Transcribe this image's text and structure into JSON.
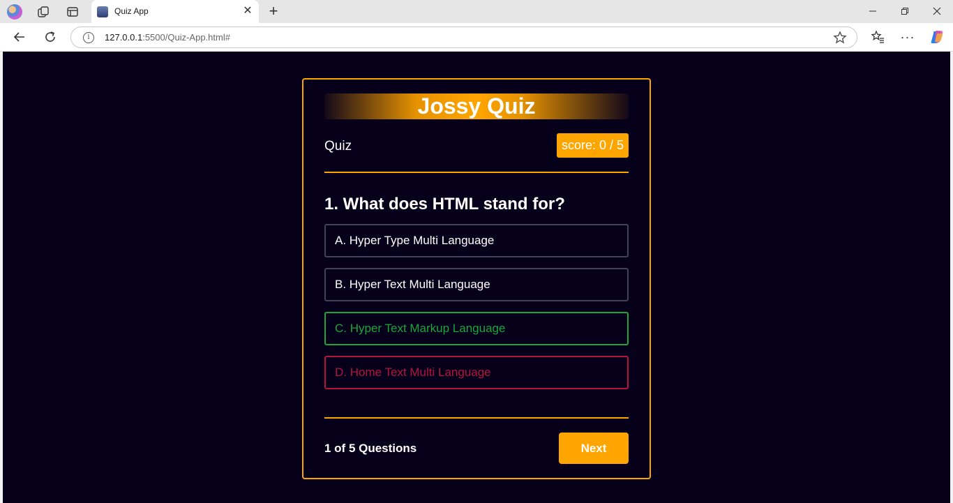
{
  "browser": {
    "tab_title": "Quiz App",
    "close_glyph": "✕",
    "new_tab_glyph": "+",
    "url_host": "127.0.0.1",
    "url_rest": ":5500/Quiz-App.html#",
    "more_glyph": "···"
  },
  "quiz": {
    "title": "Jossy Quiz",
    "section_label": "Quiz",
    "score": "score: 0 / 5",
    "question": "1. What does HTML stand for?",
    "options": [
      {
        "text": "A. Hyper Type Multi Language",
        "state": "neutral"
      },
      {
        "text": "B. Hyper Text Multi Language",
        "state": "neutral"
      },
      {
        "text": "C. Hyper Text Markup Language",
        "state": "correct"
      },
      {
        "text": "D. Home Text Multi Language",
        "state": "wrong"
      }
    ],
    "progress": "1 of 5 Questions",
    "next_label": "Next"
  },
  "colors": {
    "accent": "#ffa500",
    "background": "#07001a",
    "correct": "#1aa63a",
    "wrong": "#b3143d",
    "neutral_border": "#44415a"
  },
  "icons": [
    "profile-avatar-icon",
    "collections-icon",
    "tab-actions-icon",
    "back-arrow-icon",
    "reload-icon",
    "site-info-icon",
    "favorite-star-icon",
    "favorites-icon",
    "more-icon",
    "copilot-icon"
  ]
}
